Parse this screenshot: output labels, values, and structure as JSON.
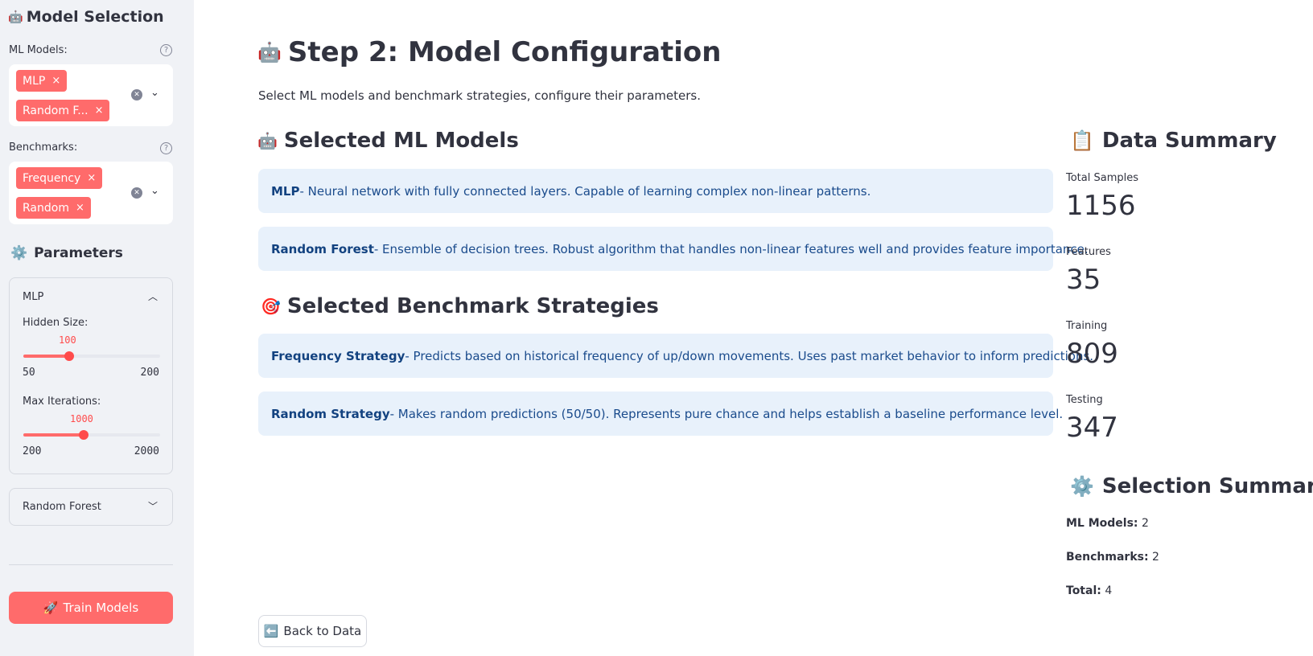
{
  "sidebar": {
    "title": "Model Selection",
    "title_emoji": "🤖",
    "ml_models_label": "ML Models:",
    "ml_models_selected": [
      "MLP",
      "Random F..."
    ],
    "benchmarks_label": "Benchmarks:",
    "benchmarks_selected": [
      "Frequency",
      "Random"
    ],
    "tag_remove_glyph": "×",
    "help_glyph": "?",
    "parameters_title": "Parameters",
    "parameters_emoji": "⚙️",
    "mlp_expander": {
      "label": "MLP",
      "expanded": true,
      "hidden_size": {
        "label": "Hidden Size:",
        "value": "100",
        "min": "50",
        "max": "200"
      },
      "max_iterations": {
        "label": "Max Iterations:",
        "value": "1000",
        "min": "200",
        "max": "2000"
      }
    },
    "rf_expander": {
      "label": "Random Forest",
      "expanded": false
    },
    "train_button": "Train Models",
    "train_emoji": "🚀"
  },
  "main": {
    "title": "Step 2: Model Configuration",
    "title_emoji": "🤖",
    "subtitle": "Select ML models and benchmark strategies, configure their parameters.",
    "models_heading": "Selected ML Models",
    "models_heading_emoji": "🤖",
    "models": [
      {
        "name": "MLP",
        "desc": " - Neural network with fully connected layers. Capable of learning complex non-linear patterns."
      },
      {
        "name": "Random Forest",
        "desc": " - Ensemble of decision trees. Robust algorithm that handles non-linear features well and provides feature importance."
      }
    ],
    "benchmarks_heading": "Selected Benchmark Strategies",
    "benchmarks_heading_emoji": "🎯",
    "benchmarks": [
      {
        "name": "Frequency Strategy",
        "desc": " - Predicts based on historical frequency of up/down movements. Uses past market behavior to inform predictions."
      },
      {
        "name": "Random Strategy",
        "desc": " - Makes random predictions (50/50). Represents pure chance and helps establish a baseline performance level."
      }
    ],
    "back_button": "Back to Data",
    "back_emoji": "⬅️"
  },
  "summary": {
    "data_heading": "Data Summary",
    "data_emoji": "📋",
    "metrics": [
      {
        "label": "Total Samples",
        "value": "1156"
      },
      {
        "label": "Features",
        "value": "35"
      },
      {
        "label": "Training",
        "value": "809"
      },
      {
        "label": "Testing",
        "value": "347"
      }
    ],
    "selection_heading": "Selection Summary",
    "selection_emoji": "⚙️",
    "selection": [
      {
        "label": "ML Models:",
        "value": "2"
      },
      {
        "label": "Benchmarks:",
        "value": "2"
      },
      {
        "label": "Total:",
        "value": "4"
      }
    ]
  },
  "slider_levels": {
    "hidden_size_fraction": 0.333,
    "max_iterations_fraction": 0.444
  },
  "colors": {
    "accent": "#ff4b4b",
    "info_bg": "#e8f1fb",
    "sidebar_bg": "#f0f2f6"
  }
}
